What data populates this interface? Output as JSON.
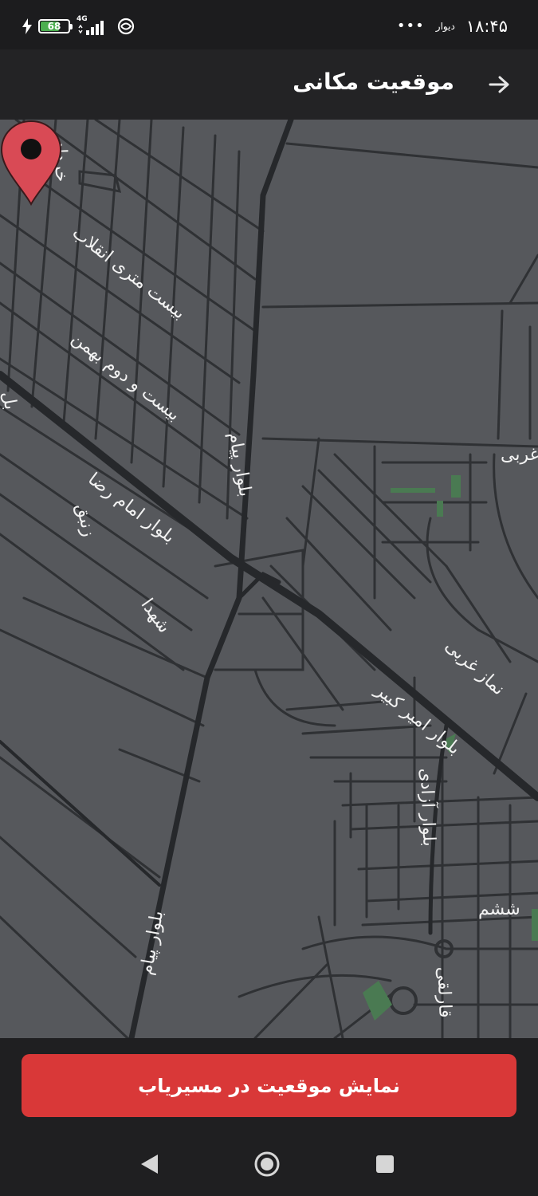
{
  "status_bar": {
    "time": "۱۸:۴۵",
    "app_badge": "دیوار",
    "overflow_dots": "•••",
    "battery_percent": "68",
    "battery_level": 0.68,
    "network_type": "4G"
  },
  "app_bar": {
    "title": "موقعیت مکانی"
  },
  "map": {
    "street_labels": [
      "خرداد",
      "بیست متری انقلاب",
      "بیست و دوم بهمن",
      "بلوار پیام",
      "بلوار امام رضا",
      "زنبق",
      "شهدا",
      "بلوار امیر کبیر",
      "نماز غربی",
      "بلوار آزادی",
      "بلوار پیام",
      "ششم",
      "قارلقی",
      "غربی",
      "بل"
    ],
    "colors": {
      "background": "#56585c",
      "road": "#2f3134",
      "major_road": "#26282b",
      "park": "#4a7a52",
      "pin": "#d94a55"
    }
  },
  "actions": {
    "show_in_router": "نمایش موقعیت در مسیریاب"
  },
  "colors": {
    "accent": "#d93838",
    "app_bar": "#232325"
  }
}
